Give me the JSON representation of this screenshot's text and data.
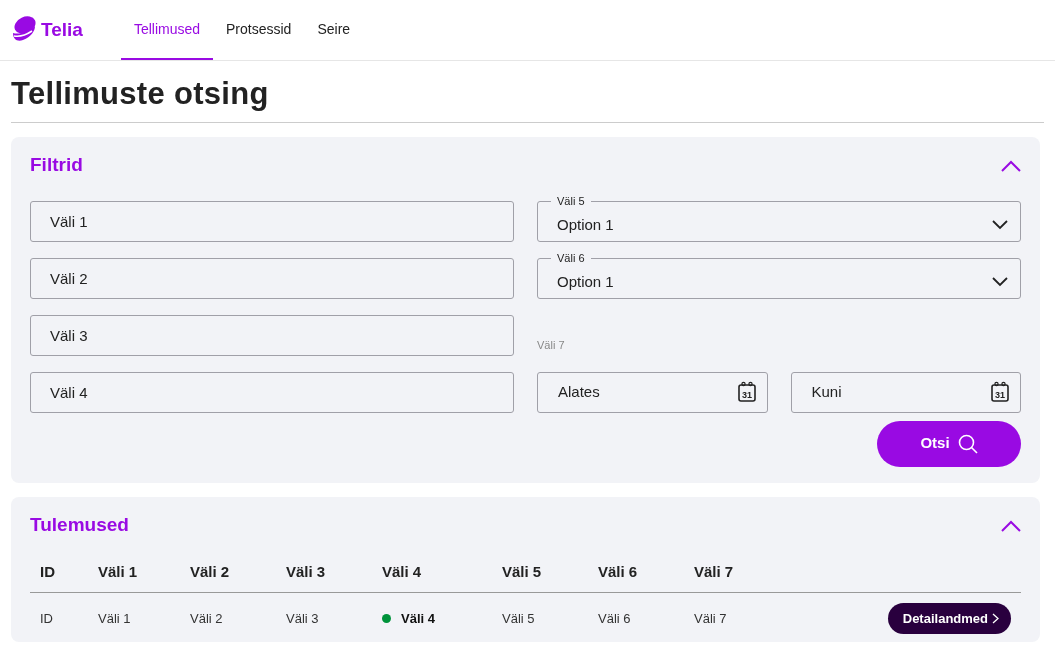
{
  "brand": {
    "name": "Telia"
  },
  "nav": [
    {
      "label": "Tellimused",
      "selected": true
    },
    {
      "label": "Protsessid",
      "selected": false
    },
    {
      "label": "Seire",
      "selected": false
    }
  ],
  "page_title": "Tellimuste otsing",
  "filters": {
    "title": "Filtrid",
    "expanded": true,
    "text_fields": [
      {
        "placeholder": "Väli 1"
      },
      {
        "placeholder": "Väli 2"
      },
      {
        "placeholder": "Väli 3"
      },
      {
        "placeholder": "Väli 4"
      }
    ],
    "selects": [
      {
        "label": "Väli 5",
        "value": "Option 1"
      },
      {
        "label": "Väli 6",
        "value": "Option 1"
      }
    ],
    "date_range": {
      "label": "Väli 7",
      "from": {
        "placeholder": "Alates",
        "icon_text": "31"
      },
      "to": {
        "placeholder": "Kuni",
        "icon_text": "31"
      }
    },
    "search_button": "Otsi"
  },
  "results": {
    "title": "Tulemused",
    "expanded": true,
    "columns": [
      "ID",
      "Väli 1",
      "Väli 2",
      "Väli 3",
      "Väli 4",
      "Väli 5",
      "Väli 6",
      "Väli 7"
    ],
    "rows": [
      {
        "cells": [
          "ID",
          "Väli 1",
          "Väli 2",
          "Väli 3",
          "Väli 4",
          "Väli 5",
          "Väli 6",
          "Väli 7"
        ],
        "color": "#00933b",
        "action": "Detailandmed"
      }
    ]
  }
}
